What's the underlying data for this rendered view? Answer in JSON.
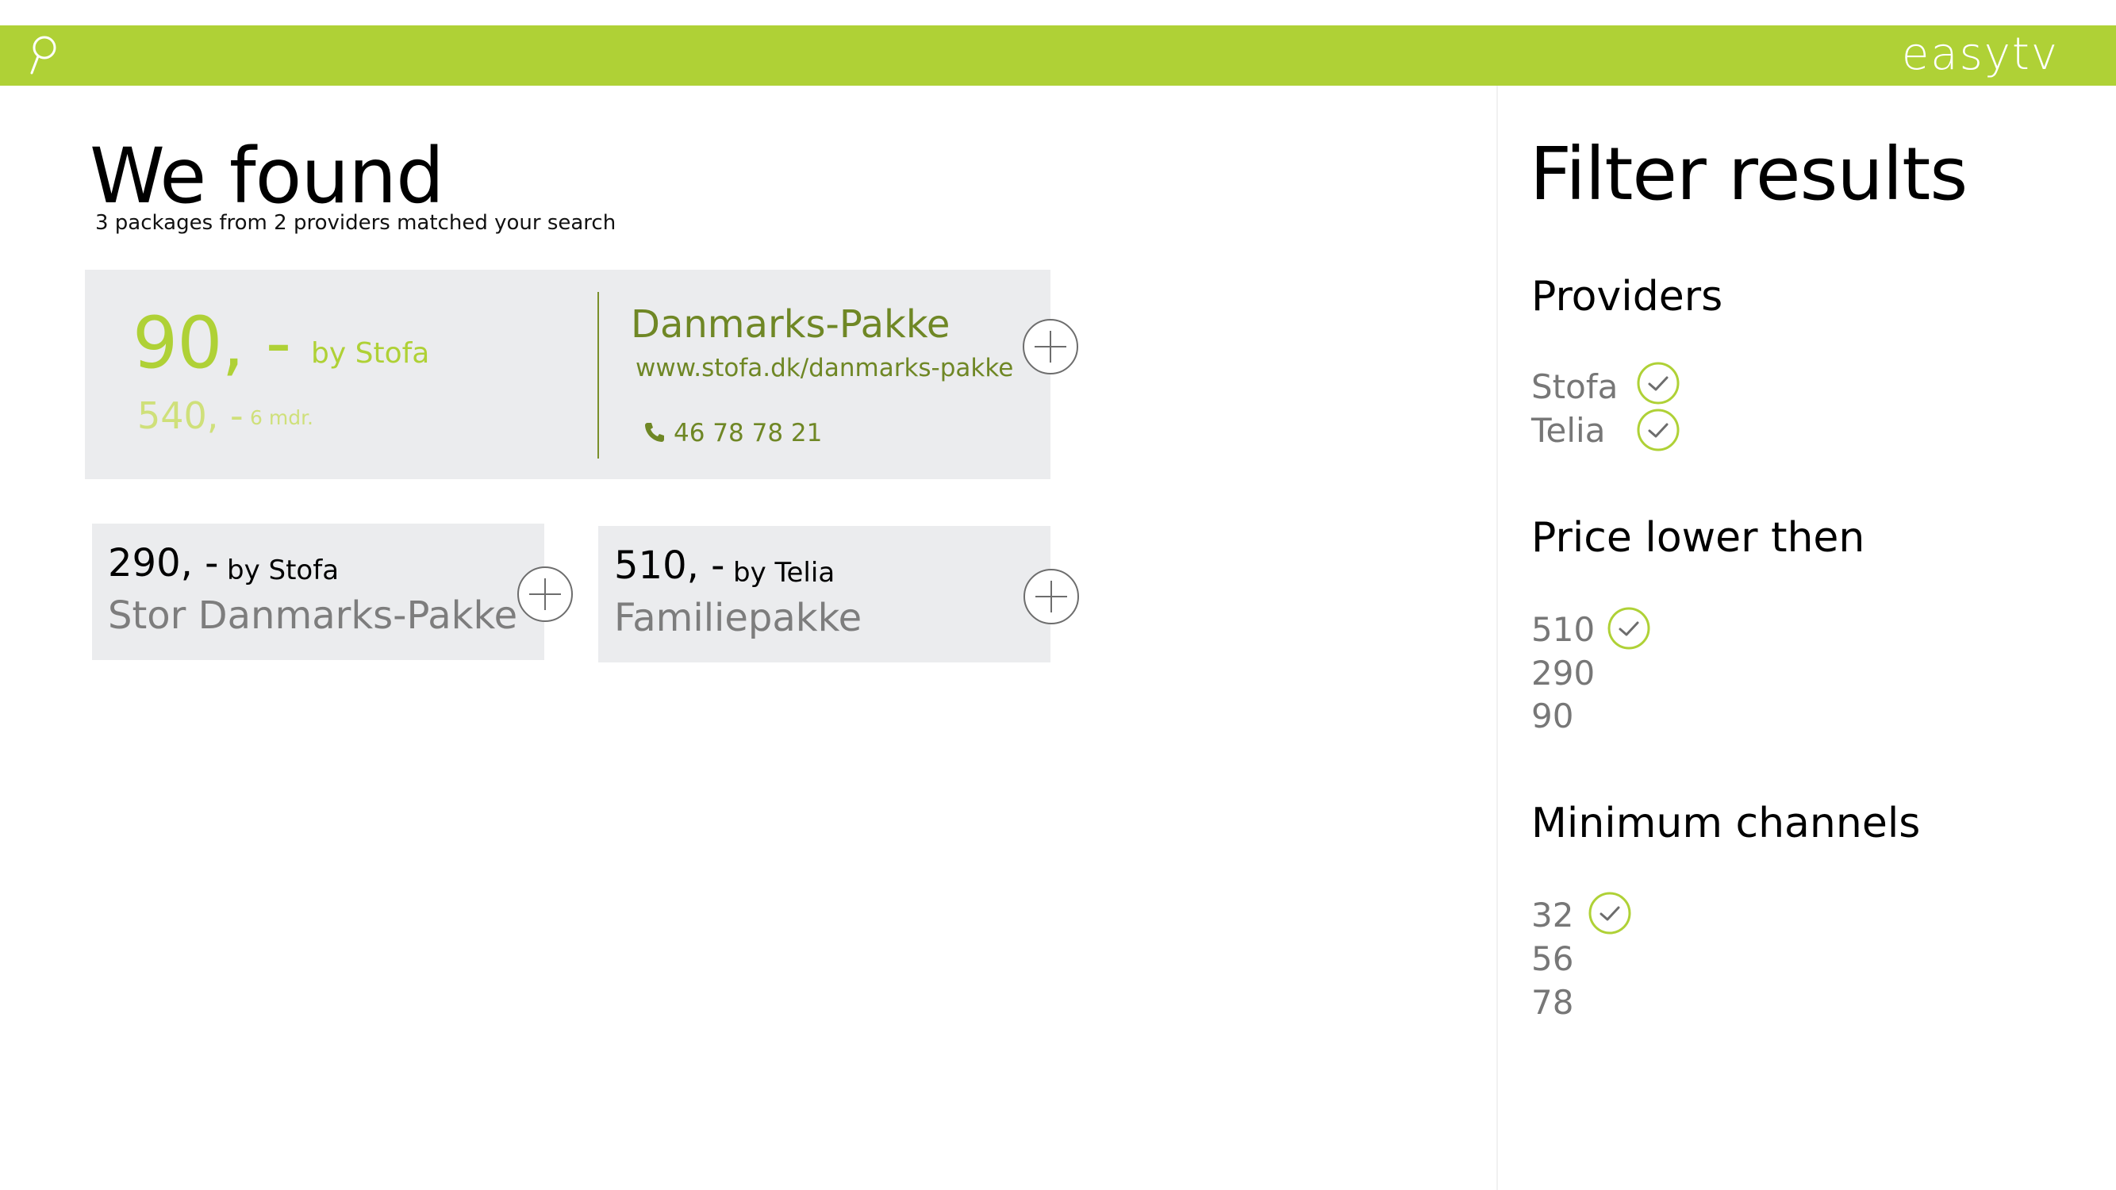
{
  "header": {
    "brand": "easytv",
    "search_icon": "search-icon",
    "bar_color": "#afd136"
  },
  "results": {
    "title": "We found",
    "subtitle": "3 packages from 2 providers matched your search",
    "featured": {
      "price": "90, -",
      "by": "by Stofa",
      "sub_price": "540, -",
      "period": "6 mdr.",
      "name": "Danmarks-Pakke",
      "url": "www.stofa.dk/danmarks-pakke",
      "phone": "46 78 78 21",
      "phone_icon": "phone-icon",
      "add_icon": "plus-circle-icon"
    },
    "packages": [
      {
        "price": "290, -",
        "by": "by Stofa",
        "name": "Stor Danmarks-Pakke",
        "add_icon": "plus-circle-icon"
      },
      {
        "price": "510, -",
        "by": "by Telia",
        "name": "Familiepakke",
        "add_icon": "plus-circle-icon"
      }
    ]
  },
  "filters": {
    "title": "Filter results",
    "providers": {
      "title": "Providers",
      "options": [
        {
          "label": "Stofa",
          "checked": true
        },
        {
          "label": "Telia",
          "checked": true
        }
      ]
    },
    "price": {
      "title": "Price lower then",
      "options": [
        {
          "label": "510",
          "checked": true
        },
        {
          "label": "290",
          "checked": false
        },
        {
          "label": "90",
          "checked": false
        }
      ]
    },
    "channels": {
      "title": "Minimum channels",
      "options": [
        {
          "label": "32",
          "checked": true
        },
        {
          "label": "56",
          "checked": false
        },
        {
          "label": "78",
          "checked": false
        }
      ]
    },
    "check_icon": "check-circle-icon",
    "accent_color": "#afd136"
  }
}
